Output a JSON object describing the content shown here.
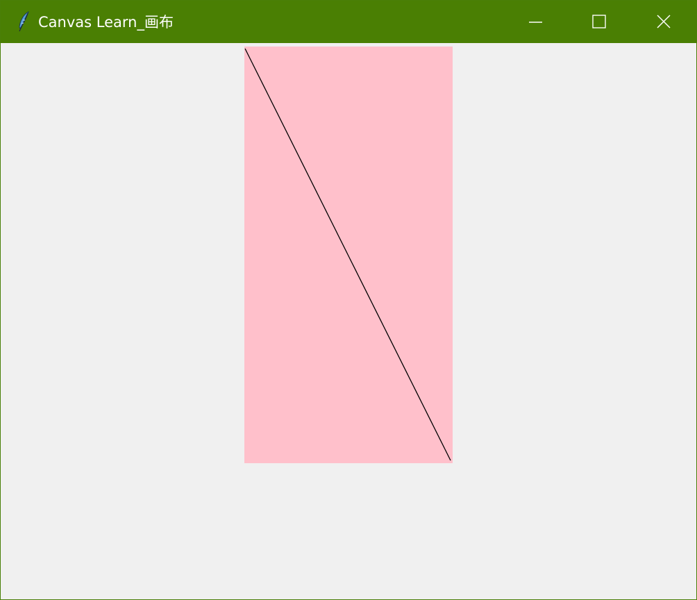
{
  "window": {
    "title": "Canvas Learn_画布",
    "icon": "feather-icon",
    "controls": [
      "minimize-icon",
      "maximize-icon",
      "close-icon"
    ],
    "titlebar_color": "#4a7f03"
  },
  "canvas": {
    "background_color": "#ffc0cb",
    "line_color": "#000000"
  }
}
